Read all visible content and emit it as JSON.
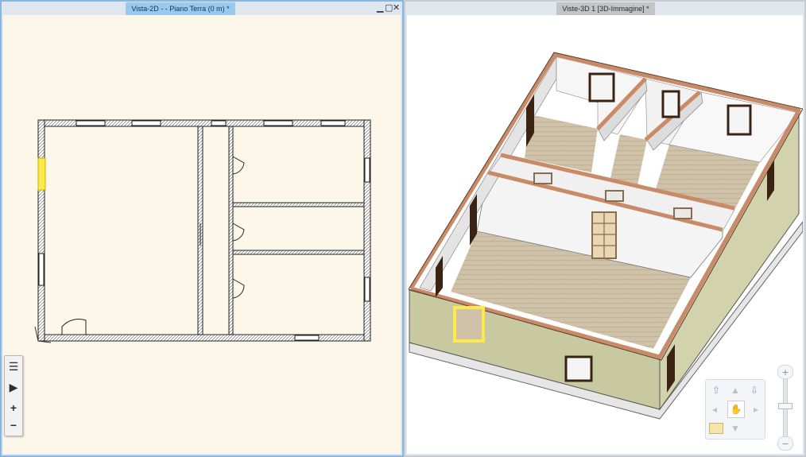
{
  "panes": {
    "left": {
      "tab_title": "Vista-2D -  - Piano Terra (0 m) *"
    },
    "right": {
      "tab_title": "Viste-3D 1 [3D-Immagine] *"
    }
  },
  "window_controls": {
    "minimize": "▁",
    "maximize": "▢",
    "close": "✕"
  },
  "toolbox": {
    "items": [
      {
        "name": "list-icon",
        "glyph": "☰"
      },
      {
        "name": "play-icon",
        "glyph": "▶"
      },
      {
        "name": "zoom-in-icon",
        "glyph": "+"
      },
      {
        "name": "zoom-out-icon",
        "glyph": "−"
      }
    ]
  },
  "nav_controls": {
    "arrows": [
      {
        "name": "tilt-up-icon",
        "glyph": "⇧"
      },
      {
        "name": "up-icon",
        "glyph": "▲"
      },
      {
        "name": "tilt-down-icon",
        "glyph": "⇩"
      },
      {
        "name": "left-icon",
        "glyph": "◂"
      },
      {
        "name": "pan-hand-icon",
        "glyph": "✋"
      },
      {
        "name": "right-icon",
        "glyph": "▸"
      },
      {
        "name": "down-icon",
        "glyph": "▼"
      }
    ],
    "zoom_in": "+",
    "zoom_out": "−"
  },
  "colors": {
    "accent_active": "#9ac9ef",
    "wall_top": "#c98a68",
    "exterior_wall": "#c8c9a0",
    "floor": "#cfc2a8",
    "plan_background": "#fdf7ea",
    "highlight": "#ffe94a"
  }
}
